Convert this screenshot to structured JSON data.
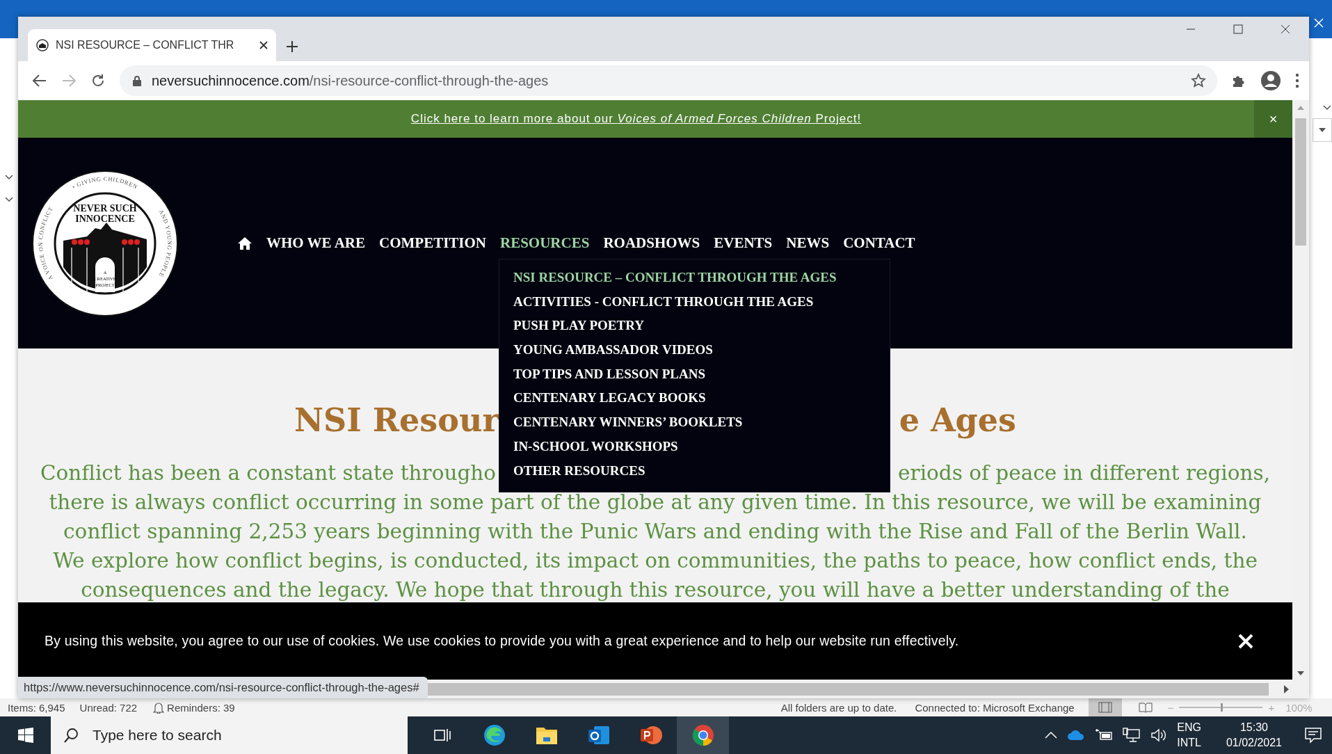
{
  "browser": {
    "tabs": [
      {
        "title": "NSI RESOURCE – CONFLICT THR",
        "selected": true
      }
    ],
    "address": {
      "domain": "neversuchinnocence.com",
      "path": "/nsi-resource-conflict-through-the-ages"
    },
    "status_url": "https://www.neversuchinnocence.com/nsi-resource-conflict-through-the-ages#"
  },
  "page": {
    "banner": {
      "text": "Click here to learn more about our *Voices of Armed Forces Children* Project!",
      "close": "×"
    },
    "logo": {
      "title_lines": [
        "NEVER SUCH",
        "INNOCENCE"
      ],
      "ring_text": [
        "A VOICE ON CONFLICT",
        "• GIVING CHILDREN",
        "AND YOUNG PEOPLE"
      ],
      "subtitle_lines": [
        "A",
        "CREATIVE",
        "PROJECT"
      ]
    },
    "nav": [
      {
        "label": "WHO WE ARE",
        "selected": false
      },
      {
        "label": "COMPETITION",
        "selected": false
      },
      {
        "label": "RESOURCES",
        "selected": true
      },
      {
        "label": "ROADSHOWS",
        "selected": false
      },
      {
        "label": "EVENTS",
        "selected": false
      },
      {
        "label": "NEWS",
        "selected": false
      },
      {
        "label": "CONTACT",
        "selected": false
      }
    ],
    "dropdown": [
      {
        "label": "NSI RESOURCE – CONFLICT THROUGH THE AGES",
        "selected": true
      },
      {
        "label": "ACTIVITIES - CONFLICT THROUGH THE AGES",
        "selected": false
      },
      {
        "label": "PUSH PLAY POETRY",
        "selected": false
      },
      {
        "label": "YOUNG AMBASSADOR VIDEOS",
        "selected": false
      },
      {
        "label": "TOP TIPS AND LESSON PLANS",
        "selected": false
      },
      {
        "label": "CENTENARY LEGACY BOOKS",
        "selected": false
      },
      {
        "label": "CENTENARY WINNERS’ BOOKLETS",
        "selected": false
      },
      {
        "label": "IN-SCHOOL WORKSHOPS",
        "selected": false
      },
      {
        "label": "OTHER RESOURCES",
        "selected": false
      }
    ],
    "heading": [
      "NSI Resour",
      "e Ages"
    ],
    "paragraph_lines": [
      [
        "Conflict has been a constant state througho",
        "eriods of peace in different regions,"
      ],
      [
        "there is always conflict occurring in some part of the globe at any given time. In this resource, we will be examining"
      ],
      [
        "conflict spanning 2,253 years beginning with the Punic Wars and ending with the Rise and Fall of the Berlin Wall."
      ],
      [
        "We explore how conflict begins, is conducted, its impact on communities, the paths to peace, how conflict ends, the"
      ],
      [
        "consequences and the legacy. We hope that through this resource, you will have a better understanding of the"
      ]
    ],
    "cookie": {
      "text": "By using this website, you agree to our use of cookies. We use cookies to provide you with a great experience and to help our website run effectively."
    }
  },
  "outlook_status": {
    "items": "Items: 6,945",
    "unread": "Unread: 722",
    "reminders": "Reminders: 39",
    "sync": "All folders are up to date.",
    "connection": "Connected to: Microsoft Exchange",
    "zoom": {
      "minus": "−",
      "plus": "+",
      "level": 0.5,
      "reading": "100%"
    }
  },
  "taskbar": {
    "search": {
      "placeholder": "Type here to search"
    },
    "apps": [
      {
        "kind": "task-view",
        "selected": false
      },
      {
        "kind": "edge",
        "selected": false
      },
      {
        "kind": "explorer",
        "selected": false
      },
      {
        "kind": "outlook",
        "selected": false
      },
      {
        "kind": "powerpoint",
        "selected": false
      },
      {
        "kind": "chrome",
        "selected": true
      }
    ],
    "language": [
      "ENG",
      "INTL"
    ],
    "time": "15:30",
    "date": "01/02/2021"
  }
}
